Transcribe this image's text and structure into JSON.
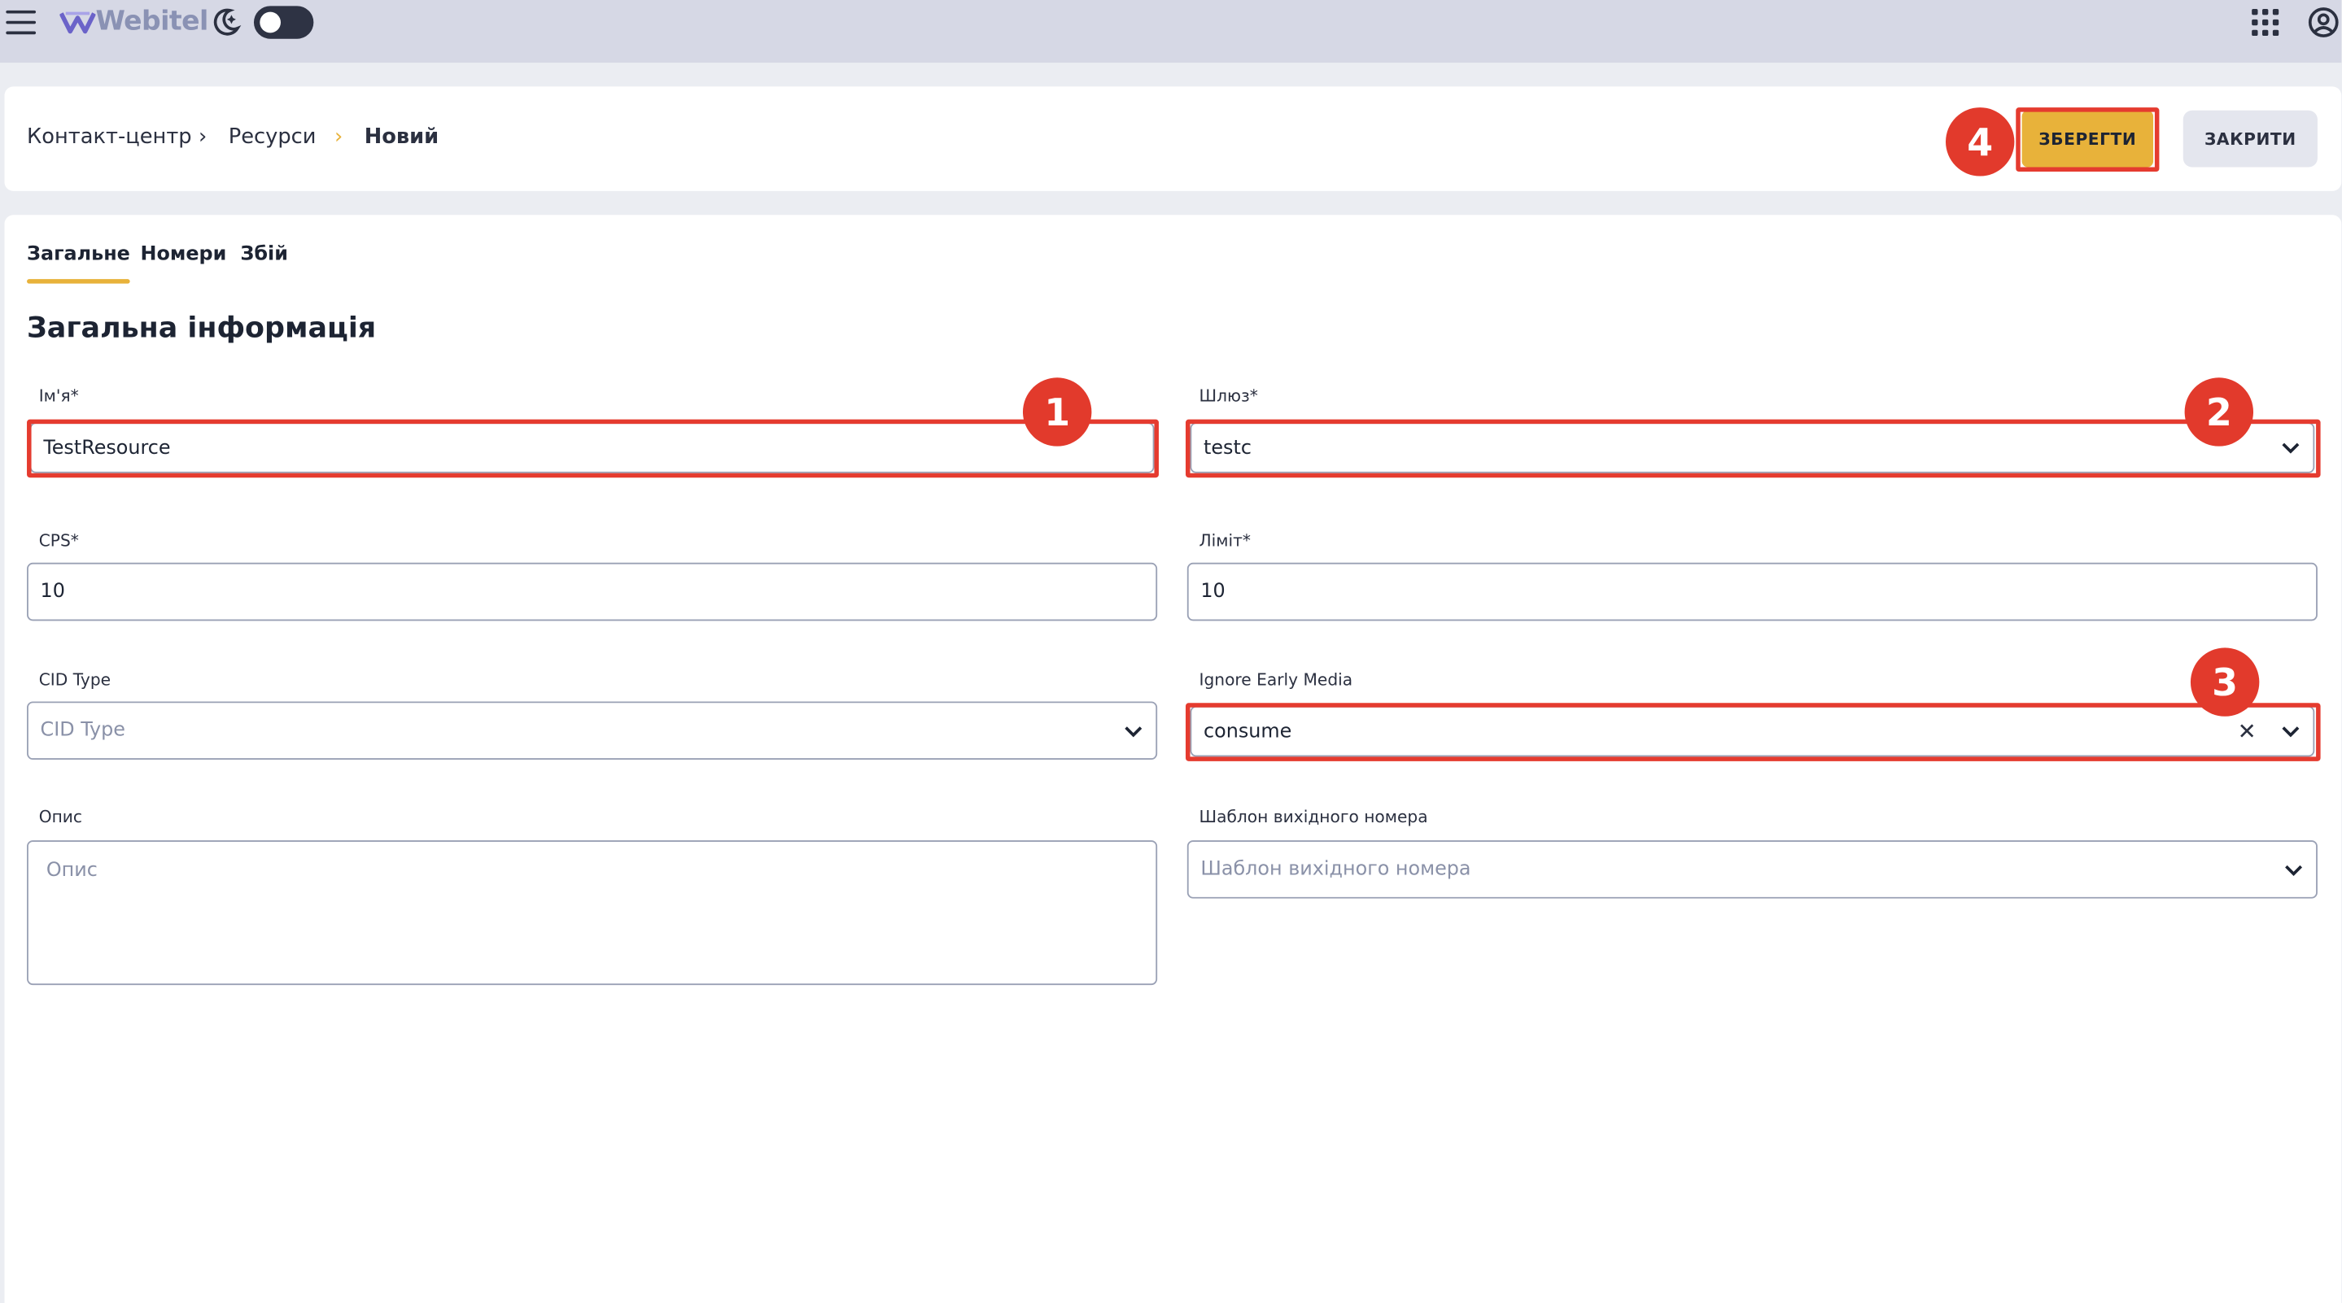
{
  "app": {
    "name": "Webitel"
  },
  "topbar": {
    "menu_icon": "hamburger-icon",
    "theme_icon": "moon-icon",
    "apps_icon": "grid-icon",
    "account_icon": "user-icon"
  },
  "breadcrumb": {
    "items": [
      "Контакт-центр",
      "Ресурси",
      "Новий"
    ],
    "separator": "›"
  },
  "actions": {
    "save_label": "ЗБЕРЕГТИ",
    "close_label": "ЗАКРИТИ"
  },
  "tabs": [
    {
      "label": "Загальне",
      "active": true
    },
    {
      "label": "Номери",
      "active": false
    },
    {
      "label": "Збій",
      "active": false
    }
  ],
  "section_title": "Загальна інформація",
  "form": {
    "name": {
      "label": "Ім'я*",
      "value": "TestResource"
    },
    "gateway": {
      "label": "Шлюз*",
      "value": "testc"
    },
    "cps": {
      "label": "CPS*",
      "value": "10"
    },
    "limit": {
      "label": "Ліміт*",
      "value": "10"
    },
    "cid_type": {
      "label": "CID Type",
      "placeholder": "CID Type"
    },
    "ignore_early_media": {
      "label": "Ignore Early Media",
      "value": "consume",
      "clear_icon": "✕"
    },
    "description": {
      "label": "Опис",
      "placeholder": "Опис"
    },
    "number_template": {
      "label": "Шаблон вихідного номера",
      "placeholder": "Шаблон вихідного номера"
    }
  },
  "annotations": [
    "1",
    "2",
    "3",
    "4"
  ],
  "colors": {
    "accent": "#e8b23a",
    "annotation_red": "#e23a2c",
    "topbar_bg": "#d6d8e5",
    "page_bg": "#ebedf2"
  }
}
